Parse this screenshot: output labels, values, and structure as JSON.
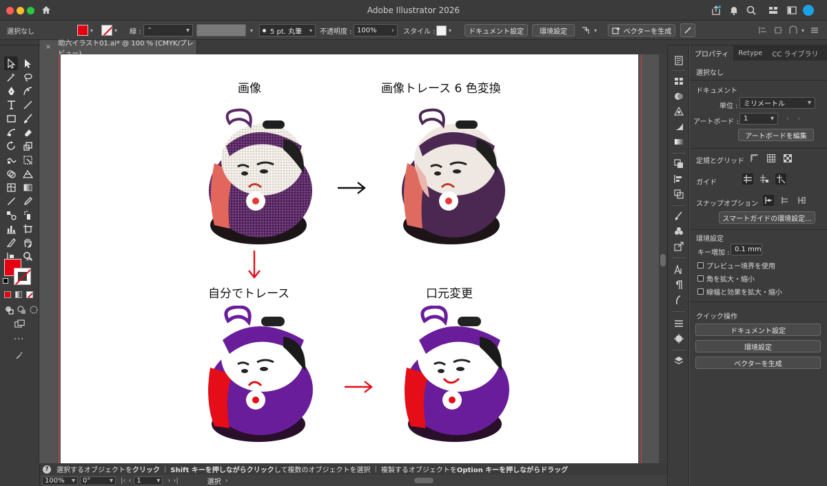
{
  "titlebar": {
    "app_title": "Adobe Illustrator 2026"
  },
  "controlbar": {
    "selection": "選択なし",
    "stroke_label": "線 :",
    "brush": "5 pt. 丸筆",
    "opacity_label": "不透明度 :",
    "opacity_value": "100%",
    "style_label": "スタイル :",
    "document_settings": "ドキュメント設定",
    "preferences": "環境設定",
    "generate_vectors": "ベクターを生成",
    "fill_color": "#e60012"
  },
  "document_tab": {
    "close": "×",
    "title": "助六イラスト01.ai* @ 100 % (CMYK/プレビュー)"
  },
  "artboard": {
    "caption_image": "画像",
    "caption_trace": "画像トレース 6 色変換",
    "caption_self_trace": "自分でトレース",
    "caption_mouth": "口元変更",
    "arrow": "→"
  },
  "statusbar": {
    "help": "?",
    "hint_1": "選択するオブジェクトを",
    "hint_1b": "クリック",
    "hint_2": "Shift キーを押しながらクリック",
    "hint_2b": "して複数のオブジェクトを選択",
    "hint_3": "複製するオブジェクトを",
    "hint_3b": "Option キーを押しながらドラッグ",
    "sep": "|"
  },
  "bottombar": {
    "zoom": "100%",
    "rotation": "0°",
    "artboard_no": "1",
    "tool": "選択"
  },
  "properties": {
    "tabs": [
      "プロパティ",
      "Retype",
      "CC ライブラリ"
    ],
    "no_selection": "選択なし",
    "document_header": "ドキュメント",
    "unit_label": "単位 :",
    "unit_value": "ミリメートル",
    "artboard_label": "アートボード :",
    "artboard_value": "1",
    "edit_artboards": "アートボードを編集",
    "rulers_grids": "定規とグリッド",
    "guides": "ガイド",
    "snap_options": "スナップオプション",
    "smart_guide_settings": "スマートガイドの環境設定...",
    "preferences_header": "環境設定",
    "key_increment_label": "キー増加 :",
    "key_increment_value": "0.1 mm",
    "check_preview_bounds": "プレビュー境界を使用",
    "check_scale_corners": "角を拡大・縮小",
    "check_scale_strokes": "線幅と効果を拡大・縮小",
    "quick_actions": "クイック操作",
    "qa_document_settings": "ドキュメント設定",
    "qa_preferences": "環境設定",
    "qa_generate_vectors": "ベクターを生成"
  }
}
